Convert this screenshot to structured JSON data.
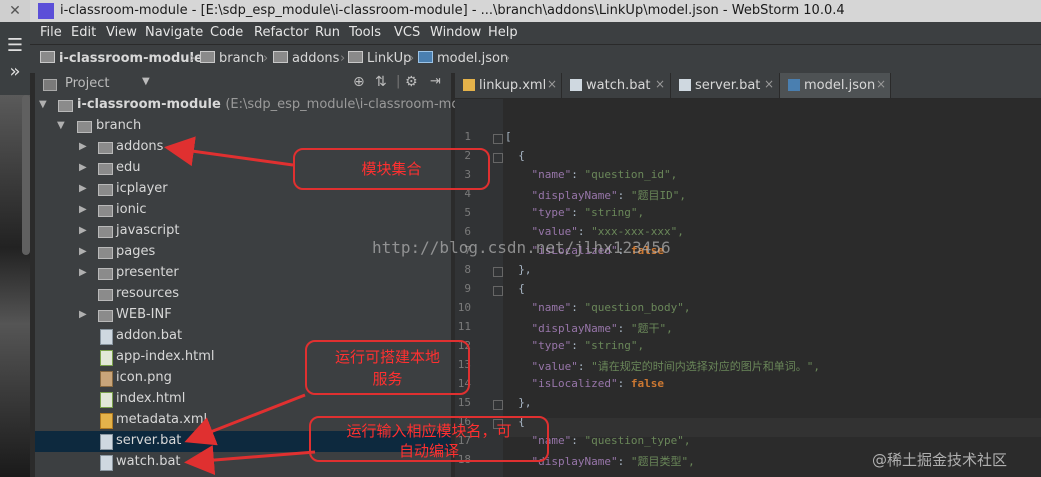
{
  "window": {
    "title": "i-classroom-module - [E:\\sdp_esp_module\\i-classroom-module] - ...\\branch\\addons\\LinkUp\\model.json - WebStorm 10.0.4"
  },
  "menu": [
    "File",
    "Edit",
    "View",
    "Navigate",
    "Code",
    "Refactor",
    "Run",
    "Tools",
    "VCS",
    "Window",
    "Help"
  ],
  "breadcrumb": [
    "i-classroom-module",
    "branch",
    "addons",
    "LinkUp",
    "model.json"
  ],
  "project_panel": {
    "title": "Project"
  },
  "tree": {
    "root": "i-classroom-module",
    "root_path": "(E:\\sdp_esp_module\\i-classroom-module)",
    "branch": "branch",
    "folders": [
      "addons",
      "edu",
      "icplayer",
      "ionic",
      "javascript",
      "pages",
      "presenter",
      "resources",
      "WEB-INF"
    ],
    "files": [
      "addon.bat",
      "app-index.html",
      "icon.png",
      "index.html",
      "metadata.xml",
      "server.bat",
      "watch.bat"
    ],
    "selected": "server.bat"
  },
  "tabs": [
    "linkup.xml",
    "watch.bat",
    "server.bat",
    "model.json"
  ],
  "active_tab": "model.json",
  "code_lines": [
    {
      "n": "1",
      "text": "["
    },
    {
      "n": "2",
      "text": "  {"
    },
    {
      "n": "3",
      "key": "\"name\"",
      "val": "\"question_id\","
    },
    {
      "n": "4",
      "key": "\"displayName\"",
      "val": "\"题目ID\","
    },
    {
      "n": "5",
      "key": "\"type\"",
      "val": "\"string\","
    },
    {
      "n": "6",
      "key": "\"value\"",
      "val": "\"xxx-xxx-xxx\","
    },
    {
      "n": "7",
      "key": "\"isLocalized\"",
      "bool": "false"
    },
    {
      "n": "8",
      "text": "  },"
    },
    {
      "n": "9",
      "text": "  {"
    },
    {
      "n": "10",
      "key": "\"name\"",
      "val": "\"question_body\","
    },
    {
      "n": "11",
      "key": "\"displayName\"",
      "val": "\"题干\","
    },
    {
      "n": "12",
      "key": "\"type\"",
      "val": "\"string\","
    },
    {
      "n": "13",
      "key": "\"value\"",
      "val": "\"请在规定的时间内选择对应的图片和单词。\","
    },
    {
      "n": "14",
      "key": "\"isLocalized\"",
      "bool": "false"
    },
    {
      "n": "15",
      "text": "  },"
    },
    {
      "n": "16",
      "text": "  {"
    },
    {
      "n": "17",
      "key": "\"name\"",
      "val": "\"question_type\","
    },
    {
      "n": "18",
      "key": "\"displayName\"",
      "val": "\"题目类型\","
    }
  ],
  "annotations": {
    "modules": "模块集合",
    "local_server_line1": "运行可搭建本地",
    "local_server_line2": "服务",
    "watch_line1": "运行输入相应模块名，可",
    "watch_line2": "自动编译"
  },
  "watermarks": {
    "blog": "http://blog.csdn.net/jlhx123456",
    "site": "@稀土掘金技术社区"
  },
  "colors": {
    "arrow": "#e03030",
    "selection": "#0d293e"
  }
}
